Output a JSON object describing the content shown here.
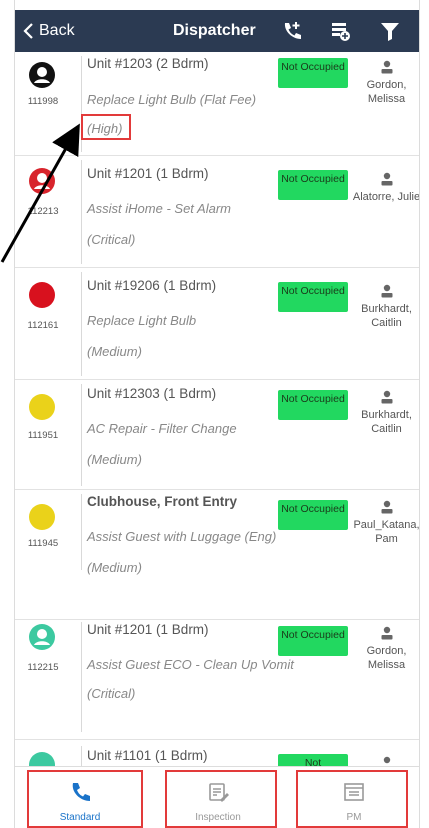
{
  "header": {
    "back_label": "Back",
    "title": "Dispatcher",
    "icons": [
      "phone-add-icon",
      "list-add-icon",
      "filter-icon"
    ]
  },
  "work_orders": [
    {
      "id": "111998",
      "unit": "Unit #1203 (2 Bdrm)",
      "task": "Replace Light Bulb (Flat Fee)",
      "priority": "(High)",
      "status": "Not Occupied",
      "assignee": "Gordon, Melissa",
      "avatar_color": "#111111"
    },
    {
      "id": "112213",
      "unit": "Unit #1201 (1 Bdrm)",
      "task": "Assist iHome - Set Alarm",
      "priority": "(Critical)",
      "status": "Not Occupied",
      "assignee": "Alatorre, Julie",
      "avatar_color": "#d8242c"
    },
    {
      "id": "112161",
      "unit": "Unit #19206 (1 Bdrm)",
      "task": "Replace Light Bulb",
      "priority": "(Medium)",
      "status": "Not Occupied",
      "assignee": "Burkhardt, Caitlin",
      "avatar_color": "#d8111e"
    },
    {
      "id": "111951",
      "unit": "Unit #12303 (1 Bdrm)",
      "task": "AC Repair - Filter Change",
      "priority": "(Medium)",
      "status": "Not Occupied",
      "assignee": "Burkhardt, Caitlin",
      "avatar_color": "#ead21a"
    },
    {
      "id": "111945",
      "unit": "Clubhouse, Front Entry",
      "task": "Assist Guest with Luggage (Eng)",
      "priority": "(Medium)",
      "status": "Not Occupied",
      "assignee": "Paul_Katana, Pam",
      "avatar_color": "#ead21a"
    },
    {
      "id": "112215",
      "unit": "Unit #1201 (1 Bdrm)",
      "task": "Assist Guest ECO - Clean Up Vomit",
      "priority": "(Critical)",
      "status": "Not Occupied",
      "assignee": "Gordon, Melissa",
      "avatar_color": "#3cc9a0"
    },
    {
      "id": "",
      "unit": "Unit #1101 (1 Bdrm)",
      "task": "",
      "priority": "",
      "status": "Not",
      "assignee": "",
      "avatar_color": "#3cc9a0"
    }
  ],
  "tabs": [
    {
      "label": "Standard",
      "active": true
    },
    {
      "label": "Inspection",
      "active": false
    },
    {
      "label": "PM",
      "active": false
    }
  ],
  "colors": {
    "header_bg": "#2b3a52",
    "status_green": "#22d860",
    "active_tab": "#1a73c9",
    "annotation_red": "#e23a3a"
  }
}
